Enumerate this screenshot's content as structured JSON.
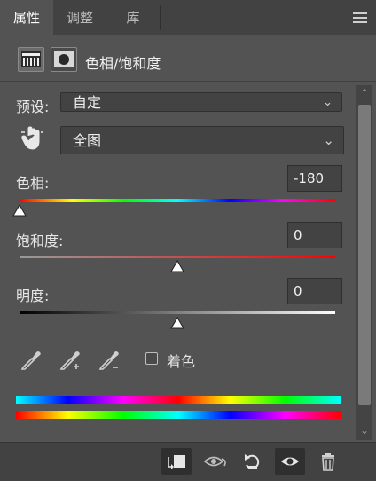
{
  "tabs": [
    {
      "label": "属性",
      "active": true
    },
    {
      "label": "调整",
      "active": false
    },
    {
      "label": "库",
      "active": false
    }
  ],
  "header": {
    "title": "色相/饱和度",
    "icons": [
      "adjustment-layer-icon",
      "mask-icon"
    ]
  },
  "preset": {
    "label": "预设:",
    "value": "自定"
  },
  "channel": {
    "value": "全图",
    "icon": "targeted-adjustment-hand-icon"
  },
  "hue": {
    "label": "色相:",
    "value": "-180",
    "slider_fraction": 0.0
  },
  "saturation": {
    "label": "饱和度:",
    "value": "0",
    "slider_fraction": 0.5
  },
  "lightness": {
    "label": "明度:",
    "value": "0",
    "slider_fraction": 0.5
  },
  "tools": [
    "eyedropper-icon",
    "eyedropper-plus-icon",
    "eyedropper-minus-icon"
  ],
  "colorize": {
    "label": "着色",
    "checked": false
  },
  "bottom_buttons": [
    "clip-to-layer-icon",
    "view-previous-state-icon",
    "reset-icon",
    "toggle-visibility-icon",
    "delete-icon"
  ],
  "colors": {
    "panel": "#535353",
    "tabbar": "#424242",
    "field": "#434343"
  }
}
